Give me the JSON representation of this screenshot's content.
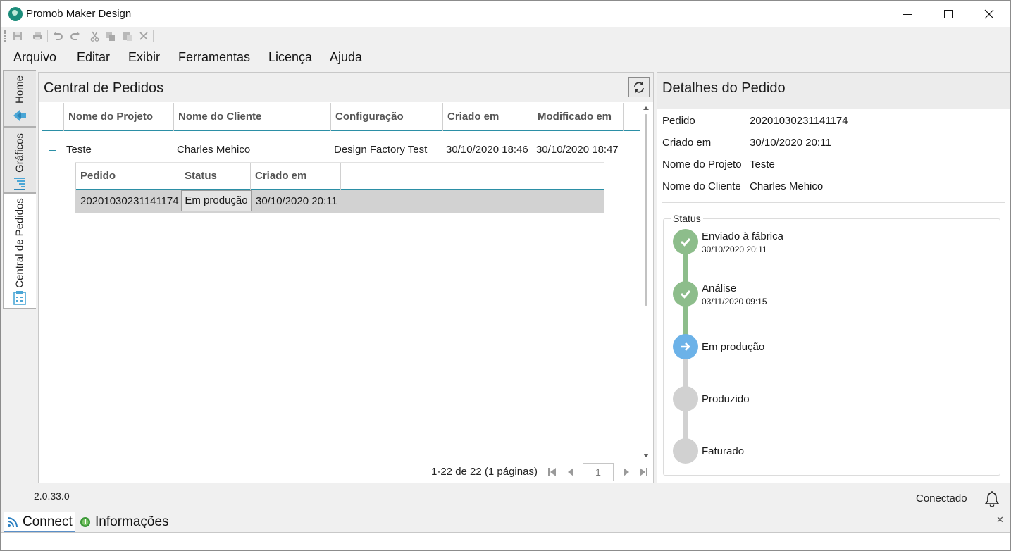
{
  "window": {
    "title": "Promob Maker Design"
  },
  "quick_toolbar": {
    "icons": [
      "save-icon",
      "print-icon",
      "undo-icon",
      "redo-icon",
      "cut-icon",
      "copy-icon",
      "paste-icon",
      "delete-icon"
    ]
  },
  "menu": {
    "items": [
      "Arquivo",
      "Editar",
      "Exibir",
      "Ferramentas",
      "Licença",
      "Ajuda"
    ]
  },
  "side_tabs": {
    "items": [
      {
        "label": "Home",
        "icon": "home-arrow-icon"
      },
      {
        "label": "Gráficos",
        "icon": "chart-icon"
      },
      {
        "label": "Central de Pedidos",
        "icon": "orders-icon"
      }
    ],
    "active": "Central de Pedidos"
  },
  "orders": {
    "title": "Central de Pedidos",
    "columns": [
      "Nome do Projeto",
      "Nome do Cliente",
      "Configuração",
      "Criado em",
      "Modificado em"
    ],
    "rows": [
      {
        "project": "Teste",
        "client": "Charles Mehico",
        "configuration": "Design Factory Test",
        "created": "30/10/2020 18:46",
        "modified": "30/10/2020 18:47",
        "sub": {
          "columns": [
            "Pedido",
            "Status",
            "Criado em"
          ],
          "rows": [
            {
              "order": "20201030231141174",
              "status": "Em produção",
              "created": "30/10/2020 20:11"
            }
          ]
        }
      }
    ],
    "pager": {
      "summary": "1-22 de 22 (1 páginas)",
      "page": "1"
    }
  },
  "details": {
    "title": "Detalhes do Pedido",
    "fields": [
      {
        "label": "Pedido",
        "value": "20201030231141174"
      },
      {
        "label": "Criado em",
        "value": "30/10/2020 20:11"
      },
      {
        "label": "Nome do Projeto",
        "value": "Teste"
      },
      {
        "label": "Nome do Cliente",
        "value": "Charles Mehico"
      }
    ],
    "status_legend": "Status",
    "timeline": [
      {
        "label": "Enviado à fábrica",
        "date": "30/10/2020 20:11",
        "state": "done"
      },
      {
        "label": "Análise",
        "date": "03/11/2020 09:15",
        "state": "done"
      },
      {
        "label": "Em produção",
        "date": "",
        "state": "current"
      },
      {
        "label": "Produzido",
        "date": "",
        "state": "pending"
      },
      {
        "label": "Faturado",
        "date": "",
        "state": "pending"
      }
    ],
    "colors": {
      "done": "#8dbd8b",
      "current": "#6cb2e8",
      "pending": "#d1d1d1"
    }
  },
  "status_bar": {
    "version": "2.0.33.0",
    "connection": "Conectado"
  },
  "bottom_tabs": {
    "items": [
      {
        "label": "Connect",
        "icon": "rss-icon"
      },
      {
        "label": "Informações",
        "icon": "info-icon"
      }
    ]
  }
}
